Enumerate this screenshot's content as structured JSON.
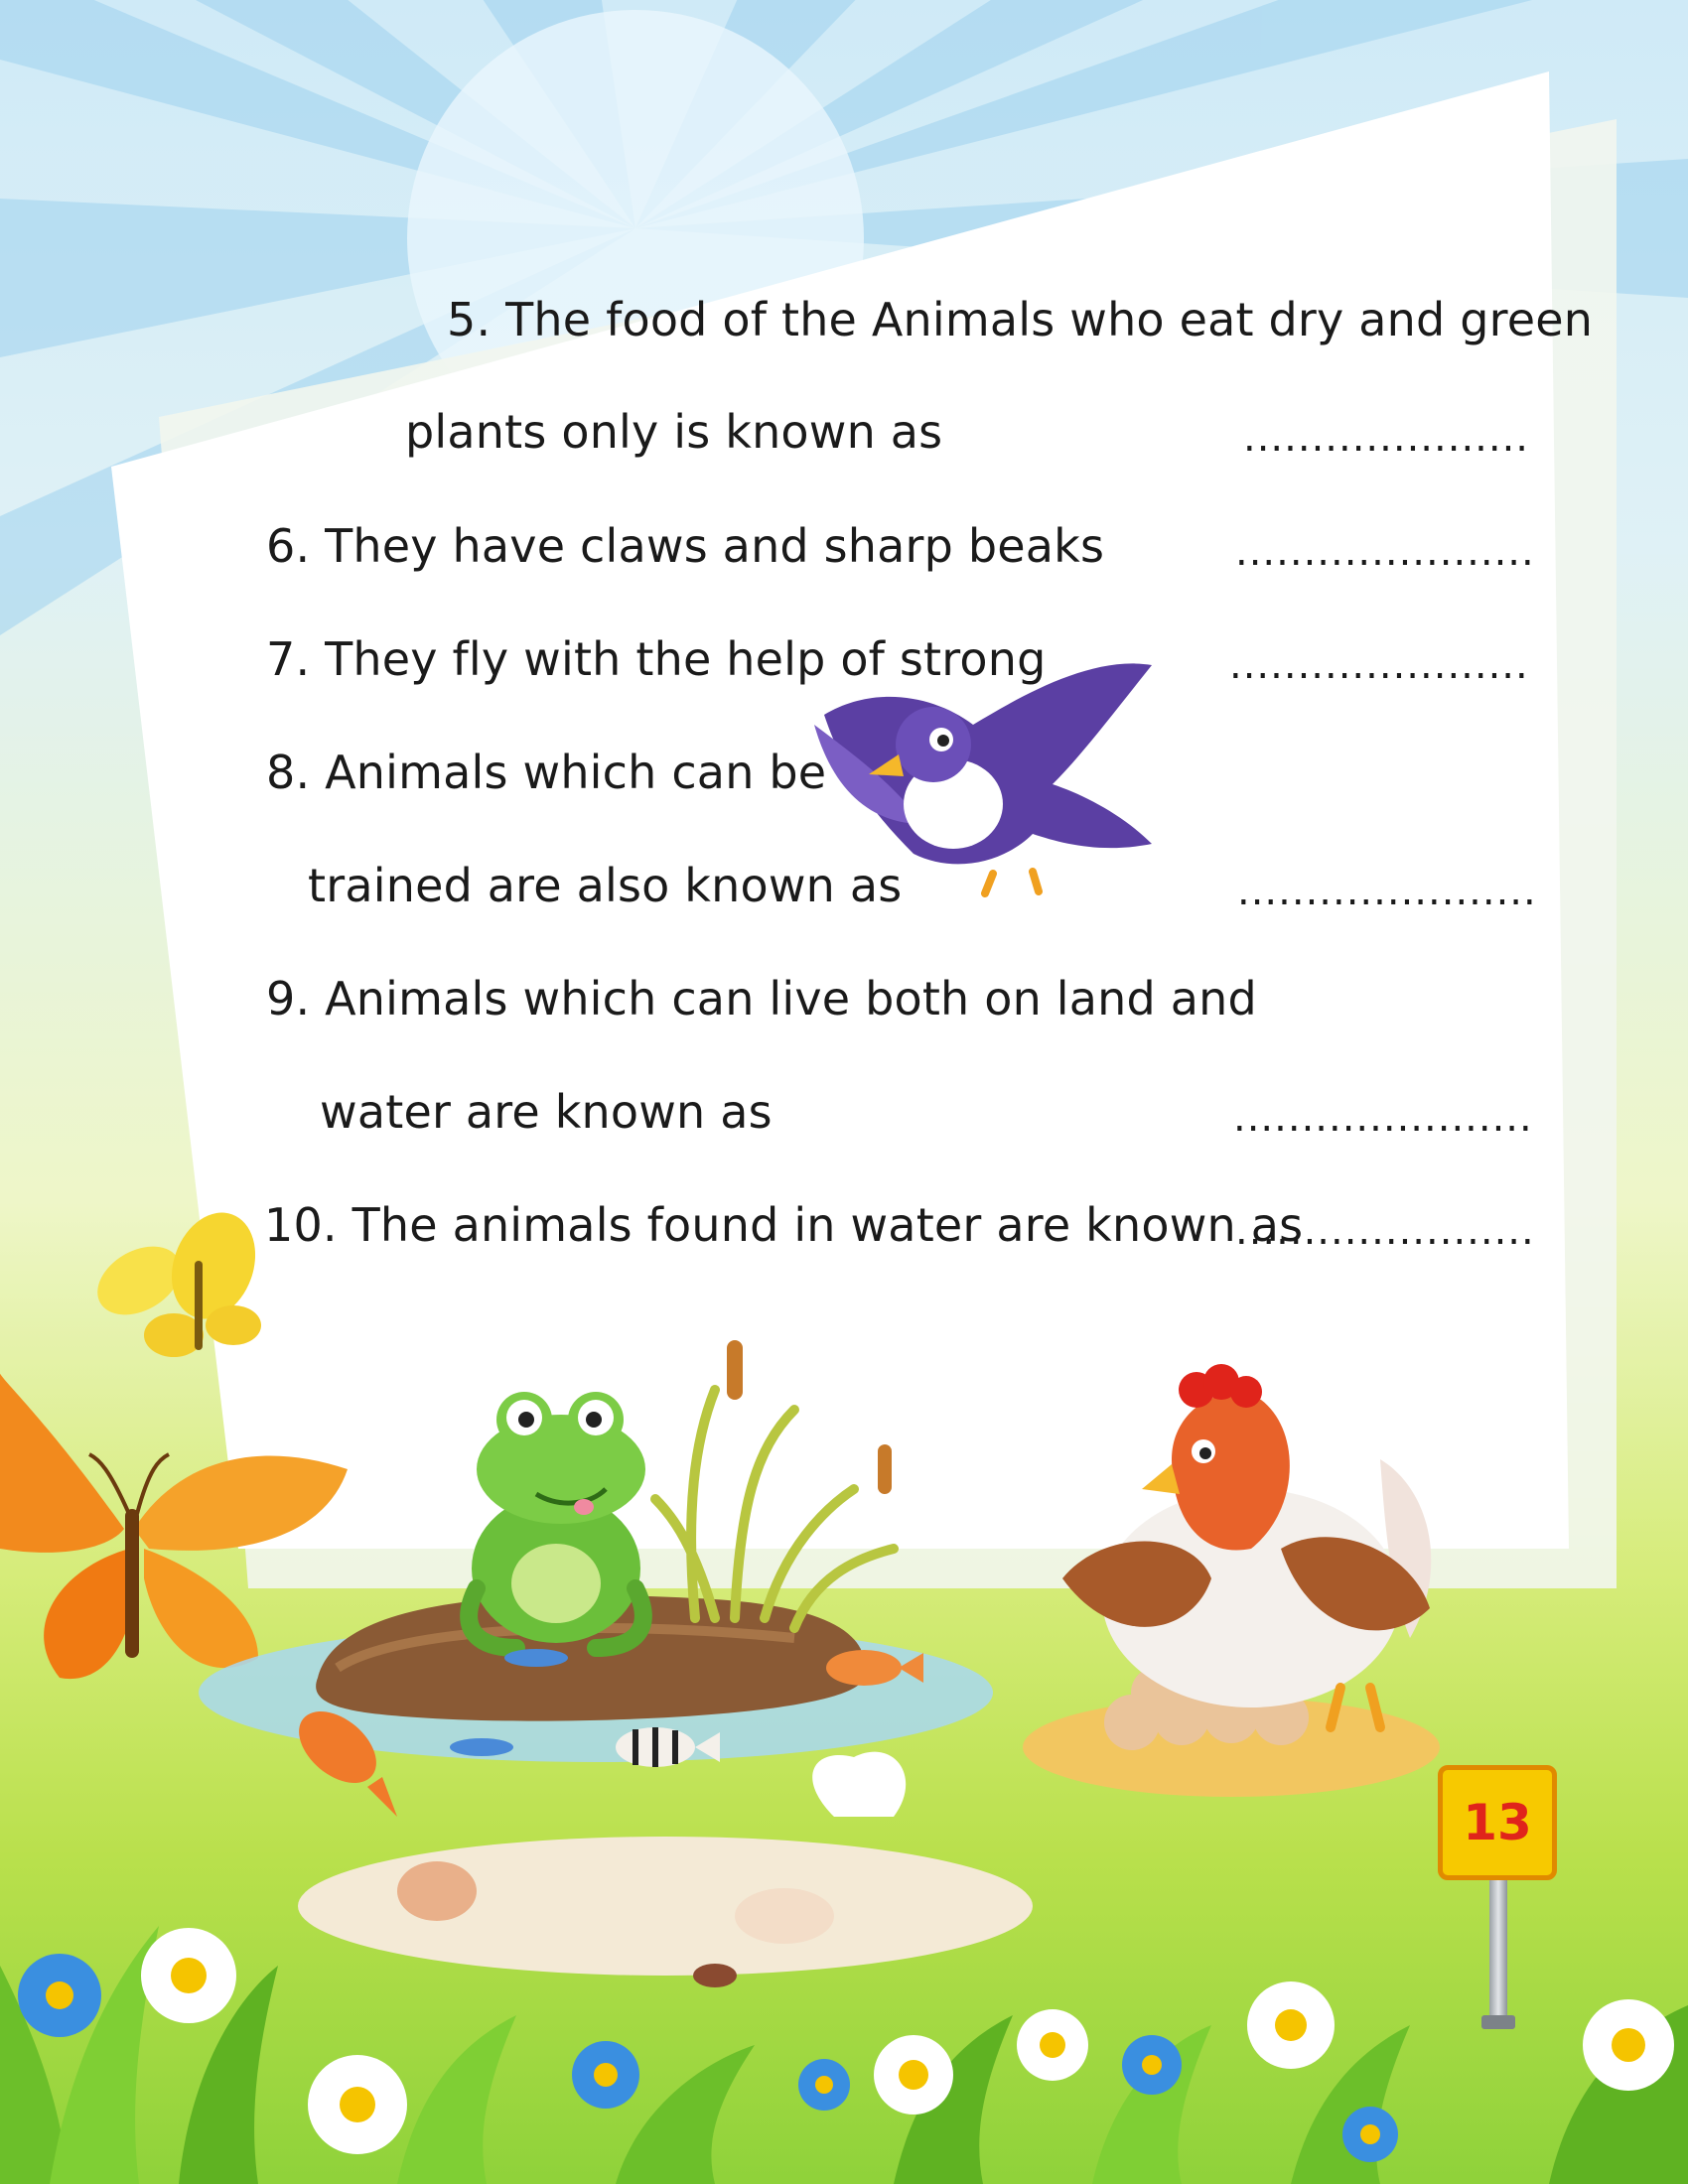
{
  "questions": [
    {
      "number": "5.",
      "text": "The food of the Animals who eat dry and green",
      "continuation": "plants only is known as",
      "blank": "....................."
    },
    {
      "number": "6.",
      "text": "They have claws and sharp beaks",
      "blank": "......................"
    },
    {
      "number": "7.",
      "text": "They fly with the help of strong",
      "blank": "......................"
    },
    {
      "number": "8.",
      "text": "Animals which can be",
      "continuation": "trained are also known as",
      "blank": "......................"
    },
    {
      "number": "9.",
      "text": "Animals which can live both on land and",
      "continuation": "water are known as",
      "blank": "......................"
    },
    {
      "number": "10.",
      "text": "The animals found in water are known as",
      "blank": "......................"
    }
  ],
  "page_number": "13",
  "illustrations": [
    "sun-icon",
    "bird-icon",
    "butterfly-icon",
    "frog-icon",
    "hen-icon",
    "fish-icon",
    "flower-icon",
    "grass-icon"
  ],
  "colors": {
    "sky": "#cfeaf7",
    "grass": "#8fd23a",
    "sign": "#f7c900",
    "sign_text": "#e0241b"
  }
}
